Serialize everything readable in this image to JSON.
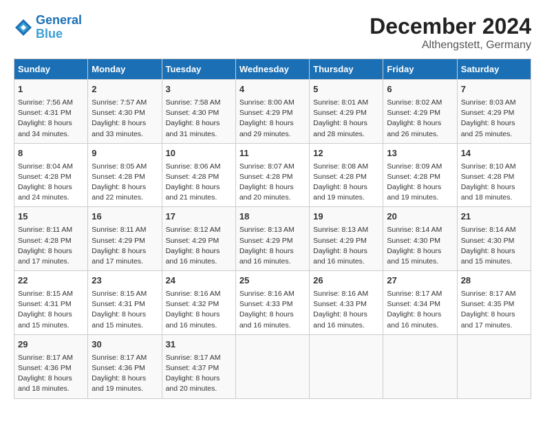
{
  "header": {
    "logo_line1": "General",
    "logo_line2": "Blue",
    "title": "December 2024",
    "subtitle": "Althengstett, Germany"
  },
  "days_of_week": [
    "Sunday",
    "Monday",
    "Tuesday",
    "Wednesday",
    "Thursday",
    "Friday",
    "Saturday"
  ],
  "weeks": [
    [
      {
        "day": 1,
        "info": "Sunrise: 7:56 AM\nSunset: 4:31 PM\nDaylight: 8 hours\nand 34 minutes."
      },
      {
        "day": 2,
        "info": "Sunrise: 7:57 AM\nSunset: 4:30 PM\nDaylight: 8 hours\nand 33 minutes."
      },
      {
        "day": 3,
        "info": "Sunrise: 7:58 AM\nSunset: 4:30 PM\nDaylight: 8 hours\nand 31 minutes."
      },
      {
        "day": 4,
        "info": "Sunrise: 8:00 AM\nSunset: 4:29 PM\nDaylight: 8 hours\nand 29 minutes."
      },
      {
        "day": 5,
        "info": "Sunrise: 8:01 AM\nSunset: 4:29 PM\nDaylight: 8 hours\nand 28 minutes."
      },
      {
        "day": 6,
        "info": "Sunrise: 8:02 AM\nSunset: 4:29 PM\nDaylight: 8 hours\nand 26 minutes."
      },
      {
        "day": 7,
        "info": "Sunrise: 8:03 AM\nSunset: 4:29 PM\nDaylight: 8 hours\nand 25 minutes."
      }
    ],
    [
      {
        "day": 8,
        "info": "Sunrise: 8:04 AM\nSunset: 4:28 PM\nDaylight: 8 hours\nand 24 minutes."
      },
      {
        "day": 9,
        "info": "Sunrise: 8:05 AM\nSunset: 4:28 PM\nDaylight: 8 hours\nand 22 minutes."
      },
      {
        "day": 10,
        "info": "Sunrise: 8:06 AM\nSunset: 4:28 PM\nDaylight: 8 hours\nand 21 minutes."
      },
      {
        "day": 11,
        "info": "Sunrise: 8:07 AM\nSunset: 4:28 PM\nDaylight: 8 hours\nand 20 minutes."
      },
      {
        "day": 12,
        "info": "Sunrise: 8:08 AM\nSunset: 4:28 PM\nDaylight: 8 hours\nand 19 minutes."
      },
      {
        "day": 13,
        "info": "Sunrise: 8:09 AM\nSunset: 4:28 PM\nDaylight: 8 hours\nand 19 minutes."
      },
      {
        "day": 14,
        "info": "Sunrise: 8:10 AM\nSunset: 4:28 PM\nDaylight: 8 hours\nand 18 minutes."
      }
    ],
    [
      {
        "day": 15,
        "info": "Sunrise: 8:11 AM\nSunset: 4:28 PM\nDaylight: 8 hours\nand 17 minutes."
      },
      {
        "day": 16,
        "info": "Sunrise: 8:11 AM\nSunset: 4:29 PM\nDaylight: 8 hours\nand 17 minutes."
      },
      {
        "day": 17,
        "info": "Sunrise: 8:12 AM\nSunset: 4:29 PM\nDaylight: 8 hours\nand 16 minutes."
      },
      {
        "day": 18,
        "info": "Sunrise: 8:13 AM\nSunset: 4:29 PM\nDaylight: 8 hours\nand 16 minutes."
      },
      {
        "day": 19,
        "info": "Sunrise: 8:13 AM\nSunset: 4:29 PM\nDaylight: 8 hours\nand 16 minutes."
      },
      {
        "day": 20,
        "info": "Sunrise: 8:14 AM\nSunset: 4:30 PM\nDaylight: 8 hours\nand 15 minutes."
      },
      {
        "day": 21,
        "info": "Sunrise: 8:14 AM\nSunset: 4:30 PM\nDaylight: 8 hours\nand 15 minutes."
      }
    ],
    [
      {
        "day": 22,
        "info": "Sunrise: 8:15 AM\nSunset: 4:31 PM\nDaylight: 8 hours\nand 15 minutes."
      },
      {
        "day": 23,
        "info": "Sunrise: 8:15 AM\nSunset: 4:31 PM\nDaylight: 8 hours\nand 15 minutes."
      },
      {
        "day": 24,
        "info": "Sunrise: 8:16 AM\nSunset: 4:32 PM\nDaylight: 8 hours\nand 16 minutes."
      },
      {
        "day": 25,
        "info": "Sunrise: 8:16 AM\nSunset: 4:33 PM\nDaylight: 8 hours\nand 16 minutes."
      },
      {
        "day": 26,
        "info": "Sunrise: 8:16 AM\nSunset: 4:33 PM\nDaylight: 8 hours\nand 16 minutes."
      },
      {
        "day": 27,
        "info": "Sunrise: 8:17 AM\nSunset: 4:34 PM\nDaylight: 8 hours\nand 16 minutes."
      },
      {
        "day": 28,
        "info": "Sunrise: 8:17 AM\nSunset: 4:35 PM\nDaylight: 8 hours\nand 17 minutes."
      }
    ],
    [
      {
        "day": 29,
        "info": "Sunrise: 8:17 AM\nSunset: 4:36 PM\nDaylight: 8 hours\nand 18 minutes."
      },
      {
        "day": 30,
        "info": "Sunrise: 8:17 AM\nSunset: 4:36 PM\nDaylight: 8 hours\nand 19 minutes."
      },
      {
        "day": 31,
        "info": "Sunrise: 8:17 AM\nSunset: 4:37 PM\nDaylight: 8 hours\nand 20 minutes."
      },
      null,
      null,
      null,
      null
    ]
  ]
}
